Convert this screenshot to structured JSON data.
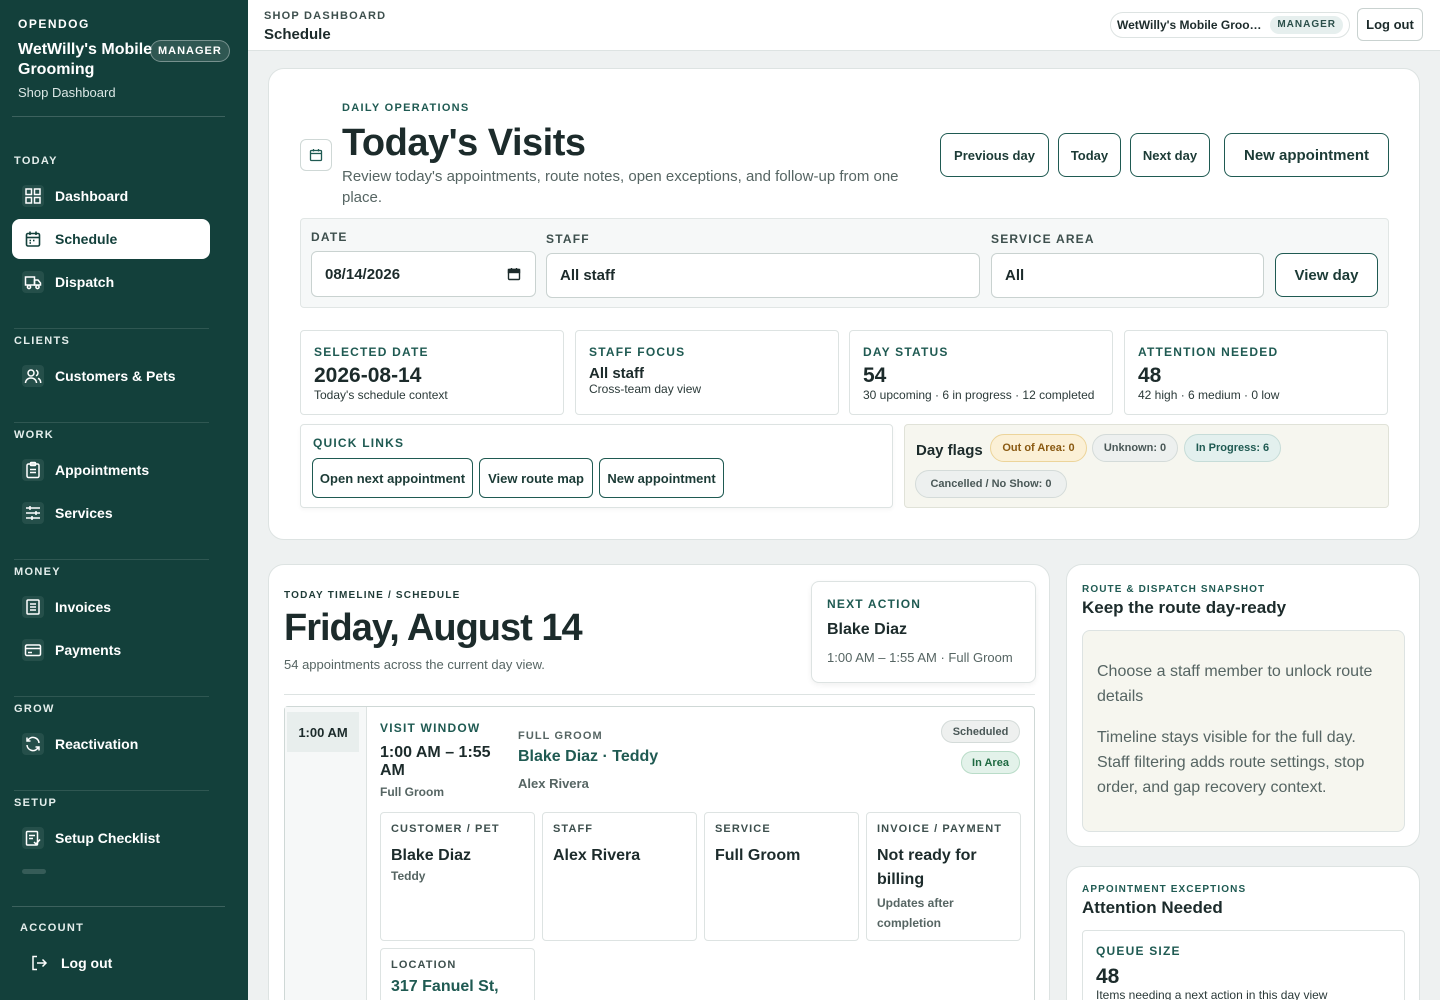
{
  "sidebar": {
    "brand_kicker": "OPENDOG",
    "brand_name": "WetWilly's Mobile Grooming",
    "brand_badge": "MANAGER",
    "brand_sub": "Shop Dashboard",
    "sections": {
      "today": "TODAY",
      "clients": "CLIENTS",
      "work": "WORK",
      "money": "MONEY",
      "grow": "GROW",
      "setup": "SETUP",
      "account": "ACCOUNT"
    },
    "items": {
      "dashboard": "Dashboard",
      "schedule": "Schedule",
      "dispatch": "Dispatch",
      "customers": "Customers & Pets",
      "appointments": "Appointments",
      "services": "Services",
      "invoices": "Invoices",
      "payments": "Payments",
      "reactivation": "Reactivation",
      "setup_checklist": "Setup Checklist",
      "logout": "Log out"
    },
    "active_item": "schedule"
  },
  "topbar": {
    "kicker": "SHOP DASHBOARD",
    "title": "Schedule",
    "account_name": "WetWilly's Mobile Grooming",
    "account_badge": "MANAGER",
    "logout": "Log out"
  },
  "hero": {
    "kicker": "DAILY OPERATIONS",
    "title": "Today's Visits",
    "description": "Review today's appointments, route notes, open exceptions, and follow-up from one place.",
    "buttons": {
      "prev": "Previous day",
      "today": "Today",
      "next": "Next day",
      "new": "New appointment"
    },
    "filters": {
      "date_label": "DATE",
      "date_value": "08/14/2026",
      "staff_label": "STAFF",
      "staff_value": "All staff",
      "area_label": "SERVICE AREA",
      "area_value": "All",
      "view_button": "View day"
    },
    "stats": [
      {
        "key": "SELECTED DATE",
        "value": "2026-08-14",
        "sub": "Today's schedule context"
      },
      {
        "key": "STAFF FOCUS",
        "value": "All staff",
        "sub": "Cross-team day view"
      },
      {
        "key": "DAY STATUS",
        "value": "54",
        "sub": "30 upcoming · 6 in progress · 12 completed"
      },
      {
        "key": "ATTENTION NEEDED",
        "value": "48",
        "sub": "42 high · 6 medium · 0 low"
      }
    ],
    "quick_links": {
      "label": "QUICK LINKS",
      "open_next": "Open next appointment",
      "route_map": "View route map",
      "new_appt": "New appointment"
    },
    "day_flags": {
      "label": "Day flags",
      "out_of_area": "Out of Area: 0",
      "unknown": "Unknown: 0",
      "in_progress": "In Progress: 6",
      "cancelled": "Cancelled / No Show: 0"
    }
  },
  "timeline": {
    "kicker": "TODAY TIMELINE / SCHEDULE",
    "title": "Friday, August 14",
    "subtitle": "54 appointments across the current day view.",
    "next_action": {
      "label": "NEXT ACTION",
      "name": "Blake Diaz",
      "detail": "1:00 AM – 1:55 AM · Full Groom"
    },
    "appointment": {
      "time_chip": "1:00 AM",
      "visit_label": "VISIT WINDOW",
      "visit_time": "1:00 AM – 1:55 AM",
      "visit_service": "Full Groom",
      "service_kicker": "FULL GROOM",
      "title": "Blake Diaz · Teddy",
      "staff": "Alex Rivera",
      "status": "Scheduled",
      "area": "In Area",
      "customer_label": "CUSTOMER / PET",
      "customer": "Blake Diaz",
      "pet": "Teddy",
      "staff_label": "STAFF",
      "staff_value": "Alex Rivera",
      "service_label": "SERVICE",
      "service_value": "Full Groom",
      "invoice_label": "INVOICE / PAYMENT",
      "invoice_value": "Not ready for billing",
      "invoice_sub": "Updates after completion",
      "location_label": "LOCATION",
      "location_value": "317 Fanuel St,"
    }
  },
  "route": {
    "kicker": "ROUTE & DISPATCH SNAPSHOT",
    "title": "Keep the route day-ready",
    "p1": "Choose a staff member to unlock route details",
    "p2": "Timeline stays visible for the full day. Staff filtering adds route settings, stop order, and gap recovery context."
  },
  "exceptions": {
    "kicker": "APPOINTMENT EXCEPTIONS",
    "title": "Attention Needed",
    "queue_label": "QUEUE SIZE",
    "queue_value": "48",
    "queue_sub": "Items needing a next action in this day view"
  }
}
